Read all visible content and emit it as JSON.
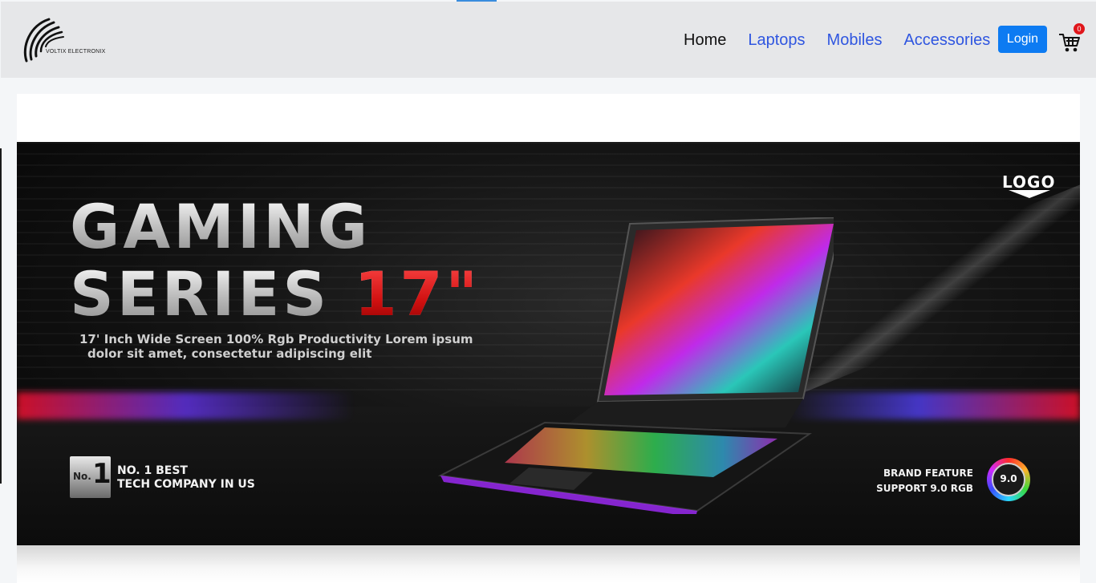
{
  "brand": {
    "name": "VOLTIX ELECTRONIX"
  },
  "nav": {
    "items": [
      {
        "label": "Home",
        "active": true
      },
      {
        "label": "Laptops",
        "active": false
      },
      {
        "label": "Mobiles",
        "active": false
      },
      {
        "label": "Accessories",
        "active": false
      }
    ],
    "login_label": "Login",
    "cart_count": "0"
  },
  "banner": {
    "headline_line1": "GAMING",
    "headline_line2": "SERIES",
    "headline_size": "17\"",
    "subline_line1": "17' Inch Wide Screen 100% Rgb Productivity Lorem ipsum",
    "subline_line2": "dolor sit amet, consectetur adipiscing elit",
    "logo_text": "LOGO",
    "badge_no": "No.",
    "badge_one": "1",
    "no1_line1": "NO. 1 BEST",
    "no1_line2": "TECH COMPANY IN US",
    "feature_line1": "BRAND FEATURE",
    "feature_line2": "SUPPORT 9.0 RGB",
    "rgb_badge": "9.0"
  },
  "colors": {
    "accent": "#0d7bf2",
    "nav_link": "#2f56e0",
    "navbar_bg": "#e6e7e9",
    "badge": "#e0161b"
  },
  "icons": {
    "cart": "shopping-cart-icon",
    "brand": "voltix-logo-icon"
  }
}
